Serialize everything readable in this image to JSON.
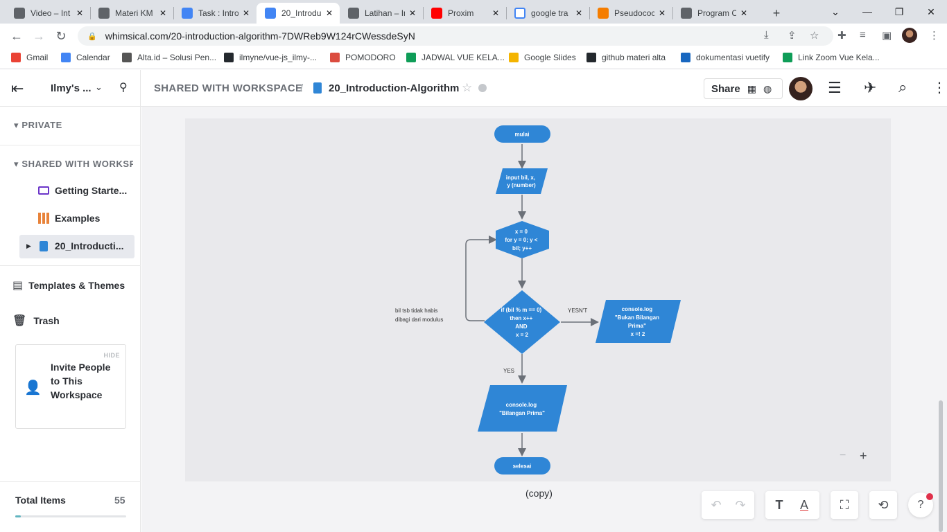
{
  "browser": {
    "tabs": [
      {
        "title": "Video – Int",
        "favicon_color": "#5f6368",
        "active": false
      },
      {
        "title": "Materi KM",
        "favicon_color": "#5f6368",
        "active": false
      },
      {
        "title": "Task : Intro",
        "favicon_color": "#4285f4",
        "active": false
      },
      {
        "title": "20_Introdu",
        "favicon_color": "#4285f4",
        "active": true
      },
      {
        "title": "Latihan – In",
        "favicon_color": "#5f6368",
        "active": false
      },
      {
        "title": "Proxim",
        "favicon_color": "#ff0000",
        "active": false
      },
      {
        "title": "google tra",
        "favicon_color": "#ffffff",
        "active": false
      },
      {
        "title": "Pseudococ",
        "favicon_color": "#f57d00",
        "active": false
      },
      {
        "title": "Program C",
        "favicon_color": "#5f6368",
        "active": false
      }
    ],
    "url": "whimsical.com/20-introduction-algorithm-7DWReb9W124rCWessdeSyN",
    "bookmarks": [
      {
        "label": "Gmail",
        "icon_color": "#ea4335"
      },
      {
        "label": "Calendar",
        "icon_color": "#4285f4"
      },
      {
        "label": "Alta.id – Solusi Pen...",
        "icon_color": "#555555"
      },
      {
        "label": "ilmyne/vue-js_ilmy-...",
        "icon_color": "#24292e"
      },
      {
        "label": "POMODORO",
        "icon_color": "#db4c3f"
      },
      {
        "label": "JADWAL VUE KELA...",
        "icon_color": "#0f9d58"
      },
      {
        "label": "Google Slides",
        "icon_color": "#f4b400"
      },
      {
        "label": "github materi alta",
        "icon_color": "#24292e"
      },
      {
        "label": "dokumentasi vuetify",
        "icon_color": "#1867c0"
      },
      {
        "label": "Link Zoom Vue Kela...",
        "icon_color": "#0f9d58"
      }
    ]
  },
  "header": {
    "workspace_name": "Ilmy's ...",
    "breadcrumb_folder": "SHARED WITH WORKSPACE",
    "breadcrumb_sep": "/",
    "doc_title": "20_Introduction-Algorithm",
    "share_label": "Share"
  },
  "sidebar": {
    "private_label": "PRIVATE",
    "shared_label": "SHARED WITH WORKSPACE",
    "items": [
      {
        "label": "Getting Starte..."
      },
      {
        "label": "Examples"
      },
      {
        "label": "20_Introducti..."
      }
    ],
    "templates_label": "Templates & Themes",
    "trash_label": "Trash",
    "invite": {
      "hide_label": "HIDE",
      "text": "Invite People to This Workspace"
    },
    "total_items_label": "Total Items",
    "total_items_count": "55",
    "usage_fraction": 0.05,
    "accent_color": "#62b5c0"
  },
  "flowchart": {
    "node_color": "#2f86d6",
    "start": "mulai",
    "input": [
      "input bil, x,",
      "y (number)"
    ],
    "loop": [
      "x = 0",
      "for y = 0; y <",
      "bil; y++"
    ],
    "decision": [
      "if (bil % m == 0)",
      "then x++",
      "AND",
      "x = 2"
    ],
    "no_branch_label": "YESN'T",
    "yes_branch_label": "YES",
    "output_no": [
      "console.log",
      "\"Bukan Bilangan",
      "Prima\"",
      "x =! 2"
    ],
    "output_yes": [
      "console.log",
      "\"Bilangan Prima\""
    ],
    "end": "selesai",
    "side_note": [
      "bil tsb tidak habis",
      "dibagi dari modulus"
    ],
    "caption": "(copy)"
  },
  "zoom": {
    "minus": "−",
    "plus": "+"
  }
}
